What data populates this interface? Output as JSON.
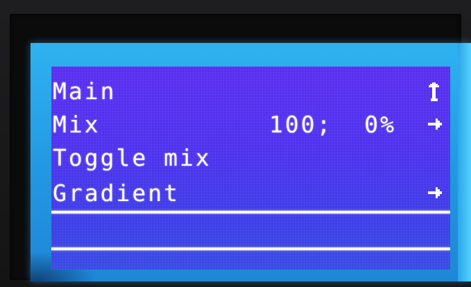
{
  "menu": {
    "items": [
      {
        "label": "Main",
        "value": "",
        "icon": "back-arrow-icon"
      },
      {
        "label": "Mix",
        "value": "100;  0%",
        "icon": "right-arrow-icon"
      },
      {
        "label": "Toggle mix",
        "value": "",
        "icon": ""
      },
      {
        "label": "Gradient",
        "value": "",
        "icon": "right-arrow-icon",
        "selected": true
      }
    ]
  },
  "colors": {
    "text": "#ffffff",
    "panel": "#4d33ee",
    "backlight": "#2297e2"
  }
}
